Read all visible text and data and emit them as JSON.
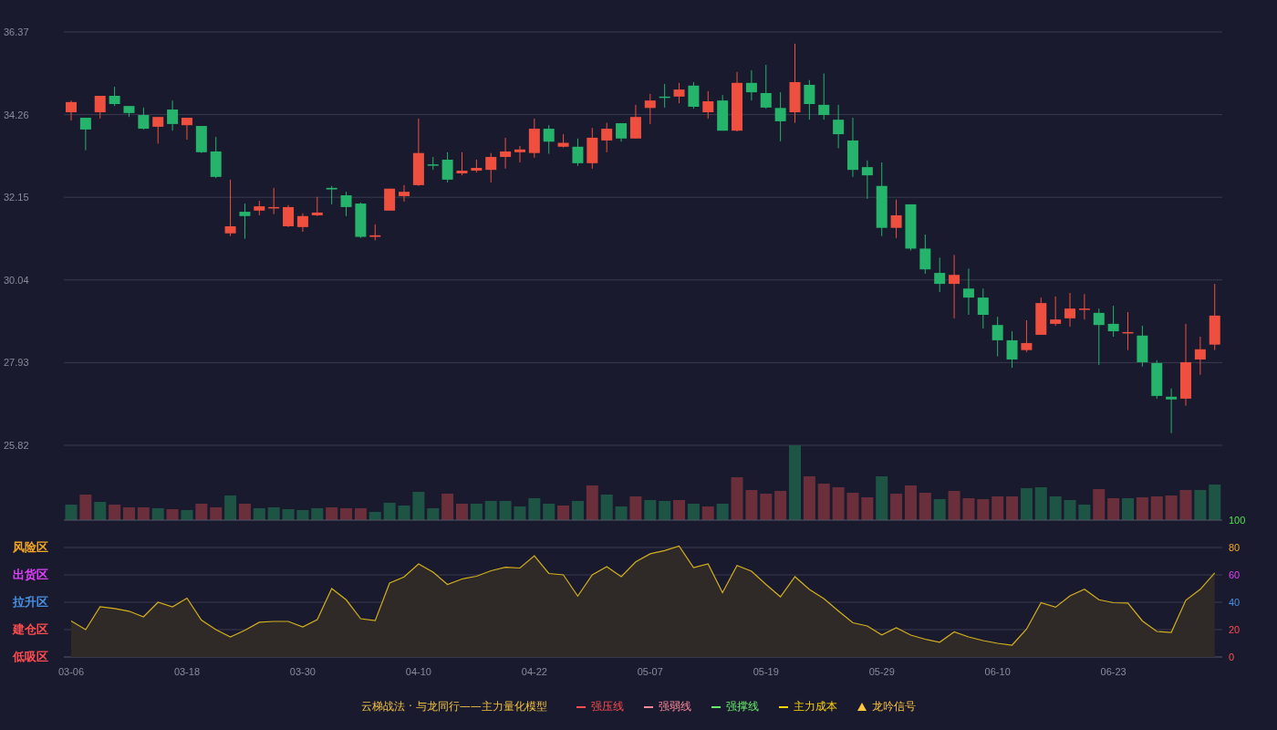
{
  "price_chart": {
    "chart_data": {
      "type": "candlestick",
      "grid": true,
      "ylim": [
        25.82,
        36.37
      ],
      "yticks": [
        {
          "value": 36.37,
          "label": "36.37"
        },
        {
          "value": 34.26,
          "label": "34.26"
        },
        {
          "value": 32.15,
          "label": "32.15"
        },
        {
          "value": 30.04,
          "label": "30.04"
        },
        {
          "value": 27.93,
          "label": "27.93"
        },
        {
          "value": 25.82,
          "label": "25.82"
        }
      ],
      "categories": [
        null,
        null,
        null,
        null,
        null,
        null,
        null,
        null,
        null,
        null,
        null,
        null,
        null,
        null,
        null,
        null,
        null,
        null,
        null,
        null,
        null,
        null,
        null,
        null,
        null,
        null,
        null,
        null,
        null,
        null,
        null,
        null,
        null,
        null,
        null,
        null,
        null,
        null,
        null,
        null,
        null,
        null,
        null,
        null,
        null,
        null,
        null,
        null,
        null,
        null,
        null,
        null,
        null,
        null,
        null,
        null,
        null,
        null,
        null,
        null,
        null,
        null,
        null,
        null,
        null,
        null,
        null,
        null,
        null,
        null,
        null,
        null,
        null,
        null,
        null,
        null,
        null,
        null,
        null,
        null
      ],
      "ohlc": [
        [
          34.32,
          34.62,
          34.11,
          34.58
        ],
        [
          34.18,
          34.18,
          33.35,
          33.88
        ],
        [
          34.32,
          34.74,
          34.16,
          34.74
        ],
        [
          34.74,
          34.97,
          34.48,
          34.53
        ],
        [
          34.48,
          34.48,
          34.2,
          34.3
        ],
        [
          34.25,
          34.44,
          33.88,
          33.9
        ],
        [
          33.95,
          34.2,
          33.52,
          34.2
        ],
        [
          34.39,
          34.62,
          33.85,
          34.02
        ],
        [
          33.99,
          34.18,
          33.62,
          34.18
        ],
        [
          33.97,
          33.97,
          33.28,
          33.3
        ],
        [
          33.32,
          33.69,
          32.64,
          32.67
        ],
        [
          31.23,
          32.6,
          31.16,
          31.41
        ],
        [
          31.78,
          31.99,
          31.09,
          31.67
        ],
        [
          31.81,
          32.06,
          31.69,
          31.92
        ],
        [
          31.89,
          32.39,
          31.72,
          31.9
        ],
        [
          31.41,
          31.95,
          31.39,
          31.9
        ],
        [
          31.39,
          31.74,
          31.27,
          31.67
        ],
        [
          31.69,
          32.16,
          31.67,
          31.76
        ],
        [
          32.39,
          32.44,
          31.97,
          32.35
        ],
        [
          32.2,
          32.29,
          31.67,
          31.9
        ],
        [
          31.99,
          32.02,
          31.11,
          31.14
        ],
        [
          31.14,
          31.46,
          31.05,
          31.18
        ],
        [
          31.81,
          32.37,
          31.81,
          32.37
        ],
        [
          32.18,
          32.46,
          32.04,
          32.29
        ],
        [
          32.46,
          34.16,
          32.44,
          33.28
        ],
        [
          32.99,
          33.18,
          32.85,
          32.98
        ],
        [
          33.11,
          33.3,
          32.53,
          32.6
        ],
        [
          32.76,
          33.3,
          32.71,
          32.83
        ],
        [
          32.83,
          33.11,
          32.78,
          32.9
        ],
        [
          32.85,
          33.28,
          32.53,
          33.18
        ],
        [
          33.18,
          33.67,
          32.88,
          33.32
        ],
        [
          33.3,
          33.46,
          33.04,
          33.37
        ],
        [
          33.28,
          34.16,
          33.16,
          33.9
        ],
        [
          33.9,
          33.99,
          33.26,
          33.57
        ],
        [
          33.44,
          33.76,
          33.42,
          33.54
        ],
        [
          33.44,
          33.65,
          32.95,
          33.02
        ],
        [
          33.02,
          33.92,
          32.88,
          33.67
        ],
        [
          33.6,
          34.05,
          33.3,
          33.9
        ],
        [
          34.04,
          34.04,
          33.57,
          33.65
        ],
        [
          33.65,
          34.51,
          33.65,
          34.2
        ],
        [
          34.43,
          34.79,
          34.02,
          34.62
        ],
        [
          34.72,
          35.04,
          34.44,
          34.71
        ],
        [
          34.72,
          35.07,
          34.55,
          34.9
        ],
        [
          35.0,
          35.09,
          34.41,
          34.46
        ],
        [
          34.32,
          34.86,
          34.16,
          34.6
        ],
        [
          34.62,
          34.76,
          33.85,
          33.85
        ],
        [
          33.85,
          35.35,
          33.83,
          35.07
        ],
        [
          35.07,
          35.39,
          34.62,
          34.83
        ],
        [
          34.81,
          35.53,
          34.41,
          34.44
        ],
        [
          34.43,
          34.83,
          33.58,
          34.09
        ],
        [
          34.32,
          36.07,
          34.05,
          35.09
        ],
        [
          35.02,
          35.14,
          34.13,
          34.53
        ],
        [
          34.51,
          35.31,
          34.13,
          34.25
        ],
        [
          34.13,
          34.51,
          33.4,
          33.76
        ],
        [
          33.6,
          34.18,
          32.67,
          32.85
        ],
        [
          32.92,
          33.09,
          32.11,
          32.71
        ],
        [
          32.44,
          33.04,
          31.16,
          31.37
        ],
        [
          31.37,
          32.09,
          31.11,
          31.69
        ],
        [
          31.97,
          31.97,
          30.79,
          30.84
        ],
        [
          30.84,
          31.2,
          30.2,
          30.31
        ],
        [
          30.22,
          30.61,
          29.73,
          29.94
        ],
        [
          29.94,
          30.68,
          29.06,
          30.17
        ],
        [
          29.82,
          30.33,
          29.15,
          29.59
        ],
        [
          29.59,
          29.82,
          28.8,
          29.15
        ],
        [
          28.89,
          29.1,
          28.09,
          28.5
        ],
        [
          28.5,
          28.73,
          27.8,
          28.01
        ],
        [
          28.25,
          29.01,
          28.2,
          28.43
        ],
        [
          28.64,
          29.59,
          28.64,
          29.45
        ],
        [
          28.92,
          29.62,
          28.87,
          29.03
        ],
        [
          29.06,
          29.71,
          28.85,
          29.31
        ],
        [
          29.3,
          29.68,
          29.03,
          29.31
        ],
        [
          29.2,
          29.31,
          27.87,
          28.89
        ],
        [
          28.92,
          29.38,
          28.59,
          28.73
        ],
        [
          28.7,
          29.22,
          28.25,
          28.71
        ],
        [
          28.62,
          28.87,
          27.83,
          27.94
        ],
        [
          27.92,
          27.99,
          27.01,
          27.08
        ],
        [
          27.06,
          27.27,
          26.13,
          26.99
        ],
        [
          27.01,
          28.92,
          26.83,
          27.94
        ],
        [
          28.01,
          28.59,
          27.62,
          28.27
        ],
        [
          28.39,
          29.94,
          28.25,
          29.13
        ]
      ]
    }
  },
  "indicator_chart": {
    "zones": [
      {
        "label": "风险区",
        "color": "#f5a623"
      },
      {
        "label": "出货区",
        "color": "#e040fb"
      },
      {
        "label": "拉升区",
        "color": "#4a90e2"
      },
      {
        "label": "建仓区",
        "color": "#ff4d4f"
      },
      {
        "label": "低吸区",
        "color": "#ff4d4f"
      }
    ],
    "chart_data": {
      "type": "area",
      "grid": true,
      "ylim": [
        0,
        100
      ],
      "yticks": [
        {
          "value": 100,
          "label": "100"
        },
        {
          "value": 80,
          "label": "80"
        },
        {
          "value": 60,
          "label": "60"
        },
        {
          "value": 40,
          "label": "40"
        },
        {
          "value": 20,
          "label": "20"
        },
        {
          "value": 0,
          "label": "0"
        }
      ],
      "categories": [
        "03-06",
        null,
        null,
        null,
        null,
        null,
        null,
        null,
        "03-18",
        null,
        null,
        null,
        null,
        null,
        null,
        null,
        "03-30",
        null,
        null,
        null,
        null,
        null,
        null,
        null,
        "04-10",
        null,
        null,
        null,
        null,
        null,
        null,
        null,
        "04-22",
        null,
        null,
        null,
        null,
        null,
        null,
        null,
        "05-07",
        null,
        null,
        null,
        null,
        null,
        null,
        null,
        "05-19",
        null,
        null,
        null,
        null,
        null,
        null,
        null,
        "05-29",
        null,
        null,
        null,
        null,
        null,
        null,
        null,
        "06-10",
        null,
        null,
        null,
        null,
        null,
        null,
        null,
        "06-23",
        null,
        null,
        null,
        null,
        null,
        null,
        null
      ],
      "series": [
        {
          "color": "#d4b01e",
          "values": [
            26.3,
            20,
            36.7,
            35.5,
            33.5,
            29.3,
            40,
            36.7,
            43,
            27,
            20,
            14.7,
            19.5,
            25.4,
            26,
            26,
            22,
            27.3,
            50,
            41.8,
            28,
            26.6,
            54,
            58.5,
            68,
            62,
            53,
            57,
            59,
            63,
            65.6,
            65,
            74,
            61,
            60,
            44.5,
            60,
            66,
            58.7,
            69.5,
            75.4,
            77.8,
            81,
            65.3,
            68,
            47,
            66.8,
            62.7,
            53,
            44,
            58.7,
            49.3,
            42.7,
            33.7,
            25,
            22.7,
            16.2,
            21.3,
            16,
            13,
            10.8,
            18.3,
            14.7,
            12,
            10,
            8.7,
            20.3,
            39.7,
            36.4,
            44.7,
            49.5,
            41.8,
            39.7,
            39.4,
            26.3,
            18.7,
            18,
            41.5,
            49.5,
            61.4
          ]
        }
      ]
    }
  },
  "legend": {
    "title": "云梯战法 · 与龙同行——主力量化模型",
    "items": [
      {
        "label": "强压线",
        "kind": "solid",
        "color": "#ff4d4f"
      },
      {
        "label": "强弱线",
        "kind": "dashed",
        "color": "#ff8a9a"
      },
      {
        "label": "强撑线",
        "kind": "solid",
        "color": "#6cf26c"
      },
      {
        "label": "主力成本",
        "kind": "dashed",
        "color": "#ffd400"
      },
      {
        "label": "龙吟信号",
        "kind": "triangle",
        "color": "#ffc53d"
      }
    ]
  }
}
